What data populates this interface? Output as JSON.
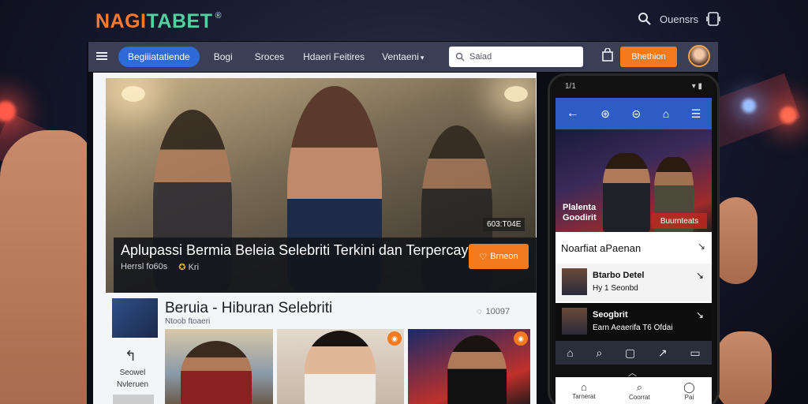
{
  "brand": {
    "part1": "NAGI",
    "part2": "TABET",
    "reg": "®"
  },
  "top_tools": {
    "label": "Ouensrs"
  },
  "navbar": {
    "pill": "Begiiiatatiende",
    "links": [
      "Bogi",
      "Sroces",
      "Hdaeri Feitires",
      "Ventaeni"
    ],
    "search_placeholder": "Saiad",
    "cta": "Bhethion"
  },
  "hero": {
    "tag": "603:T04E",
    "title": "Aplupassi Bermia Beleia Selebriti Terkini dan Terpercaya",
    "meta": [
      "Herrsl fo60s",
      "Kri"
    ],
    "button": "Brneon"
  },
  "section": {
    "title": "Beruia - Hiburan Selebriti",
    "subtitle": "Ntoob ftoaeri",
    "count": "10097"
  },
  "sidebar": {
    "text": "Seowel Nvleruen"
  },
  "phone": {
    "status_time": "1/1",
    "hero_text": "Plalenta Goodirit",
    "hero_button": "Buurnteats",
    "list_header": "Noarfiat aPaenan",
    "items": [
      {
        "title": "Btarbo Detel",
        "subtitle": "Hy 1 Seonbd"
      },
      {
        "title": "Seogbrit",
        "subtitle": "Earn Aeaerifa T6 Ofdai"
      }
    ],
    "nav": [
      "Tarnerat",
      "Coorrat",
      "Pai"
    ]
  },
  "colors": {
    "accent": "#f47a1e",
    "brand_blue": "#2f6bd8",
    "phone_bar": "#2c5cc4"
  }
}
